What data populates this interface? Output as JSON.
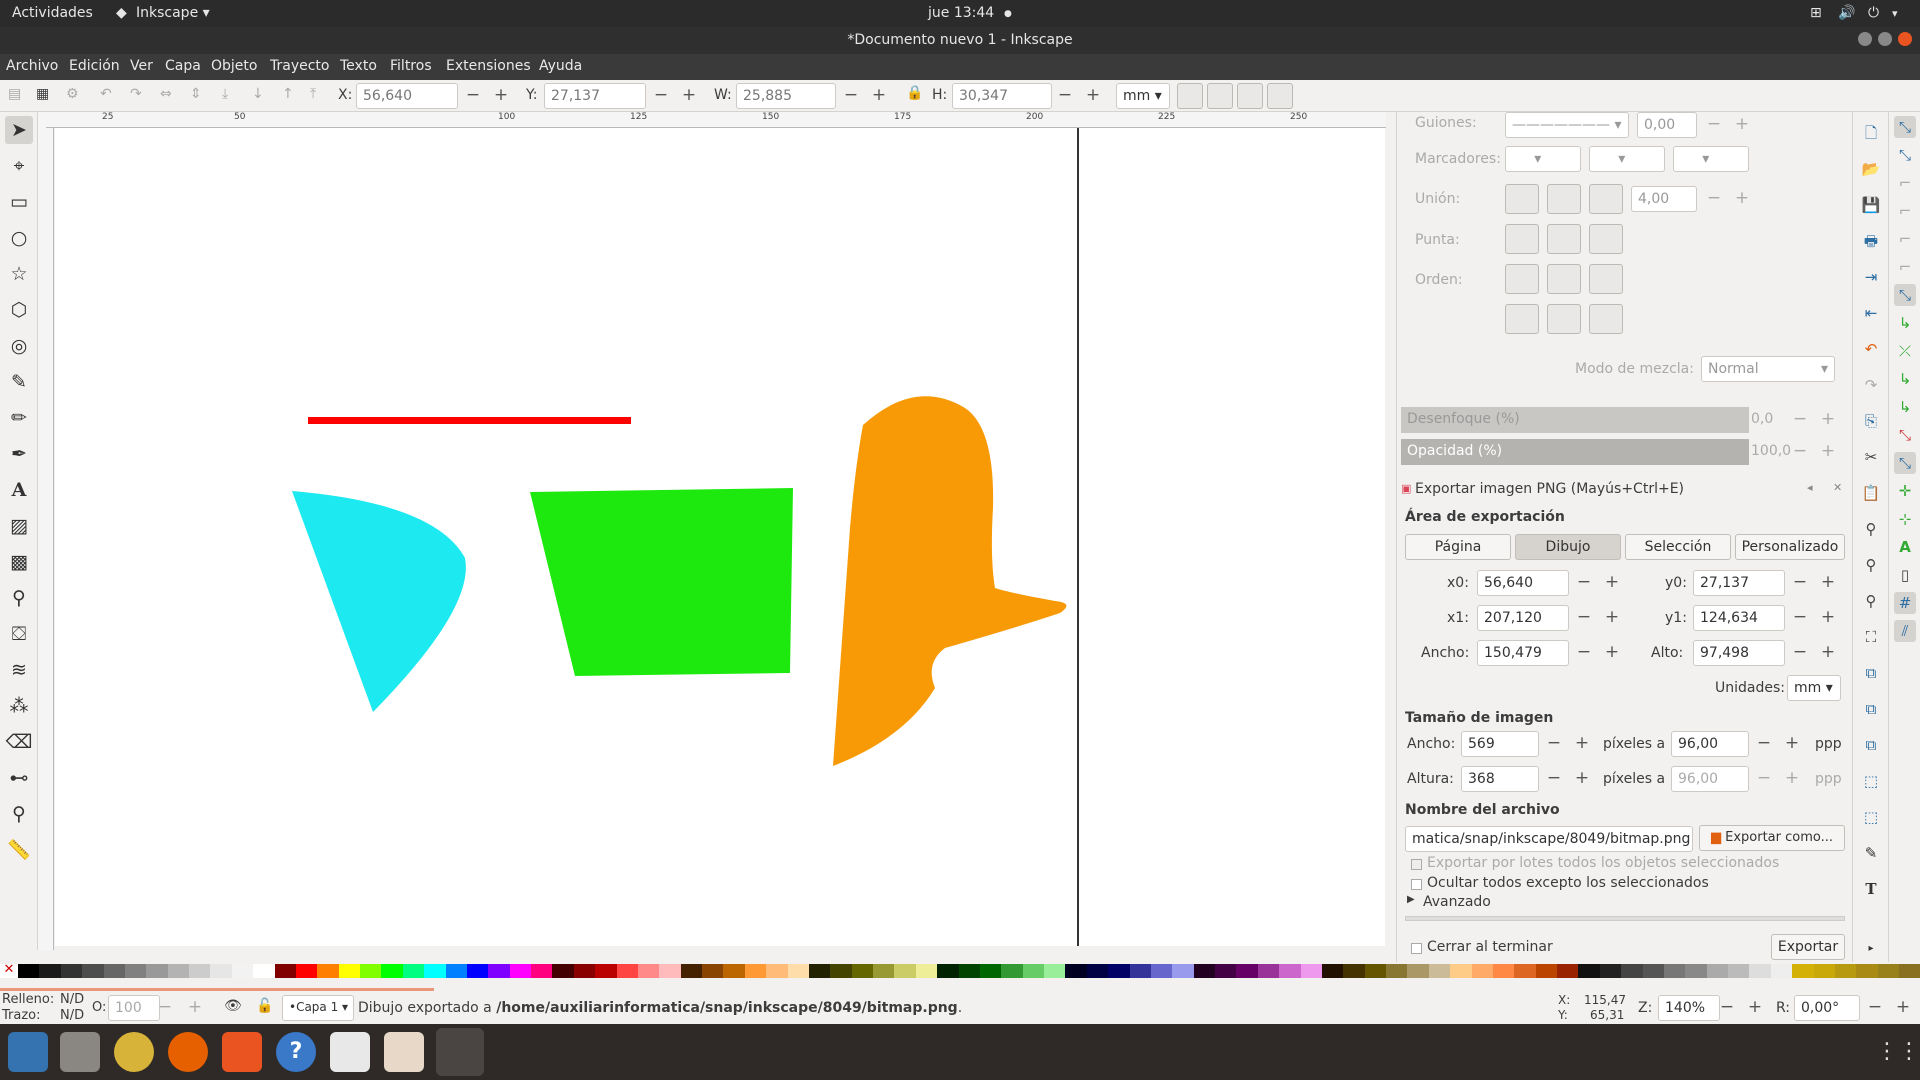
{
  "topbar": {
    "activities": "Actividades",
    "app": "Inkscape",
    "clock": "jue 13:44"
  },
  "window": {
    "title": "*Documento nuevo 1 - Inkscape"
  },
  "menu": [
    "Archivo",
    "Edición",
    "Ver",
    "Capa",
    "Objeto",
    "Trayecto",
    "Texto",
    "Filtros",
    "Extensiones",
    "Ayuda"
  ],
  "toolctl": {
    "x_label": "X:",
    "x": "56,640",
    "y_label": "Y:",
    "y": "27,137",
    "w_label": "W:",
    "w": "25,885",
    "h_label": "H:",
    "h": "30,347",
    "units": "mm"
  },
  "ruler": {
    "ticks": [
      "25",
      "50",
      "100",
      "125",
      "150",
      "175",
      "200",
      "225",
      "250"
    ]
  },
  "stroke": {
    "dashes_label": "Guiones:",
    "dashes_value": "0,00",
    "markers_label": "Marcadores:",
    "join_label": "Unión:",
    "join_value": "4,00",
    "cap_label": "Punta:",
    "order_label": "Orden:",
    "blend_label": "Modo de mezcla:",
    "blend_value": "Normal",
    "blur_label": "Desenfoque (%)",
    "blur_value": "0,0",
    "opacity_label": "Opacidad (%)",
    "opacity_value": "100,0"
  },
  "export": {
    "title": "Exportar imagen PNG (Mayús+Ctrl+E)",
    "area_header": "Área de exportación",
    "tabs": [
      "Página",
      "Dibujo",
      "Selección",
      "Personalizado"
    ],
    "active_tab": "Dibujo",
    "x0_label": "x0:",
    "x0": "56,640",
    "y0_label": "y0:",
    "y0": "27,137",
    "x1_label": "x1:",
    "x1": "207,120",
    "y1_label": "y1:",
    "y1": "124,634",
    "width_label": "Ancho:",
    "width": "150,479",
    "height_label": "Alto:",
    "height": "97,498",
    "units_label": "Unidades:",
    "units": "mm",
    "size_header": "Tamaño de imagen",
    "img_width_label": "Ancho:",
    "img_width": "569",
    "img_height_label": "Altura:",
    "img_height": "368",
    "pixels_at": "píxeles a",
    "dpi": "96,00",
    "dpi2": "96,00",
    "ppp": "ppp",
    "filename_header": "Nombre del archivo",
    "filename": "matica/snap/inkscape/8049/bitmap.png",
    "export_as": "Exportar como...",
    "batch": "Exportar por lotes todos los objetos seleccionados",
    "hide": "Ocultar todos excepto los seleccionados",
    "advanced": "Avanzado",
    "close_when_done": "Cerrar al terminar",
    "export_button": "Exportar"
  },
  "status": {
    "fill_label": "Relleno:",
    "fill": "N/D",
    "stroke_label": "Trazo:",
    "stroke": "N/D",
    "opacity_label": "O:",
    "opacity": "100",
    "layer": "•Capa 1",
    "message_prefix": "Dibujo exportado a ",
    "message_path": "/home/auxiliarinformatica/snap/inkscape/8049/bitmap.png",
    "message_suffix": ".",
    "x_label": "X:",
    "x": "115,47",
    "y_label": "Y:",
    "y": "65,31",
    "zoom_label": "Z:",
    "zoom": "140%",
    "rot_label": "R:",
    "rotation": "0,00°"
  },
  "colors": {
    "red": "#ff0000",
    "cyan": "#1de9f0",
    "green": "#1ee90f",
    "orange": "#f79a05"
  }
}
